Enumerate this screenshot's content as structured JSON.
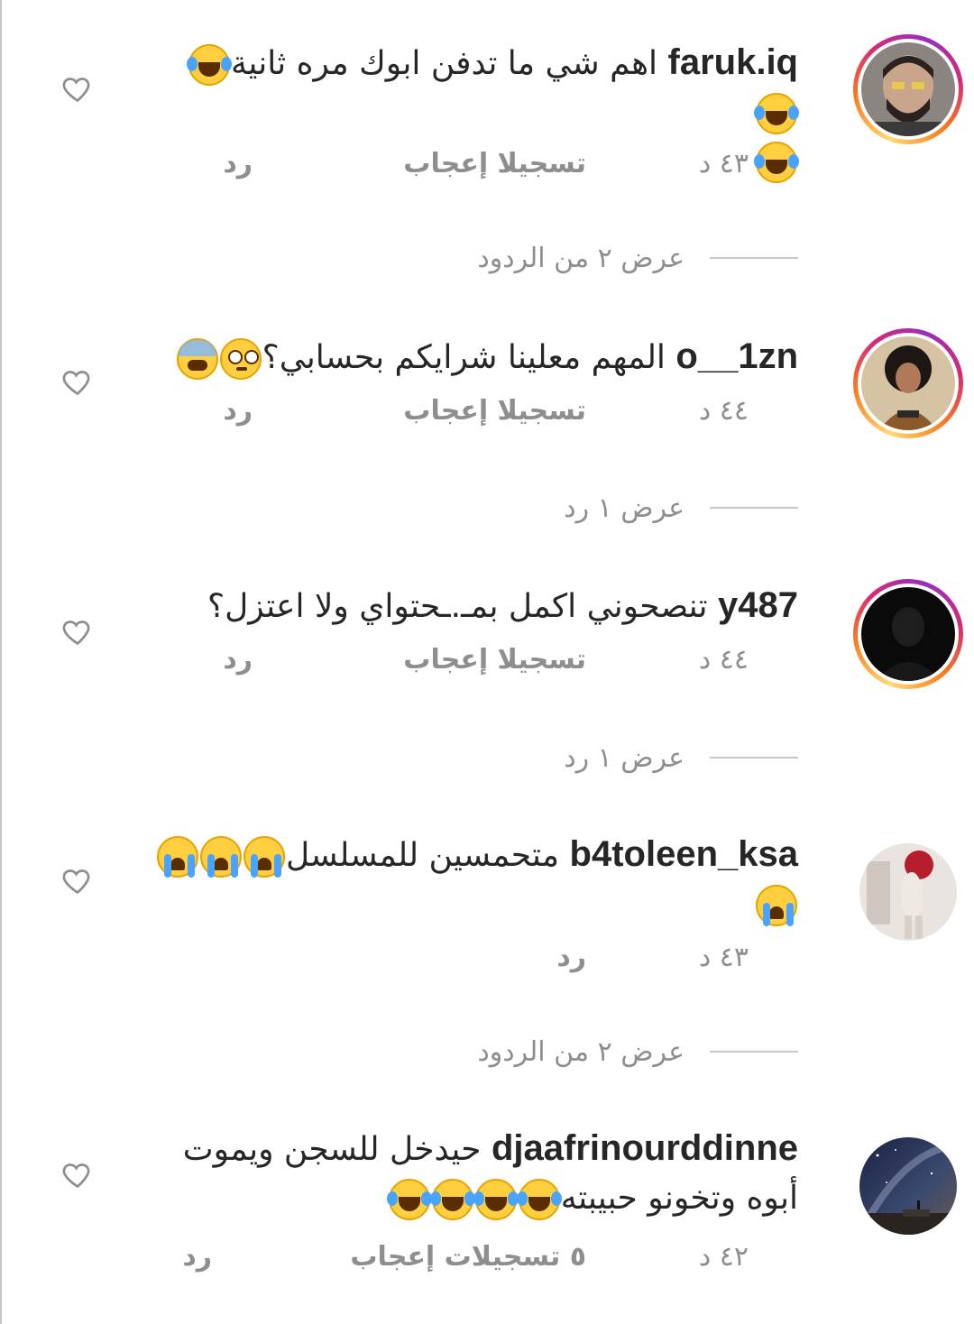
{
  "comments": [
    {
      "username": "faruk.iq",
      "text_line1": "اهم شي ما تدفن ابوك مره ثانية",
      "emojis_line1": [
        "laugh",
        "laugh"
      ],
      "emojis_line2": [
        "laugh"
      ],
      "time": "٤٣ د",
      "likes": "تسجيلا إعجاب",
      "reply": "رد",
      "has_story": true,
      "view_replies": "عرض ٢ من الردود"
    },
    {
      "username": "o__1zn",
      "text_line1": "المهم معلينا شرايكم بحسابي؟",
      "emojis_line1": [
        "flushed",
        "weary"
      ],
      "time": "٤٤ د",
      "likes": "تسجيلا إعجاب",
      "reply": "رد",
      "has_story": true,
      "view_replies": "عرض ١ رد"
    },
    {
      "username": "y487",
      "text_line1": "تنصحوني اكمل بمـ.ـحتواي ولا اعتزل؟",
      "time": "٤٤ د",
      "likes": "تسجيلا إعجاب",
      "reply": "رد",
      "has_story": true,
      "view_replies": "عرض ١ رد"
    },
    {
      "username": "b4toleen_ksa",
      "text_line1": "متحمسين للمسلسل",
      "emojis_line1": [
        "sob",
        "sob",
        "sob"
      ],
      "emojis_line2": [
        "sob"
      ],
      "time": "٤٣ د",
      "reply": "رد",
      "has_story": false,
      "view_replies": "عرض ٢ من الردود"
    },
    {
      "username": "djaafrinourddinne",
      "text_line1": "حيدخل للسجن ويموت",
      "text_line2": "أبوه وتخونو حبيبته",
      "emojis_line2": [
        "laugh",
        "laugh",
        "laugh",
        "laugh"
      ],
      "time": "٤٢ د",
      "likes": "٥ تسجيلات إعجاب",
      "reply": "رد",
      "has_story": false
    }
  ],
  "colors": {
    "text": "#262626",
    "meta": "#8e8e8e",
    "divider": "#c7c7c7"
  },
  "icons": {
    "like": "heart-outline-icon"
  }
}
